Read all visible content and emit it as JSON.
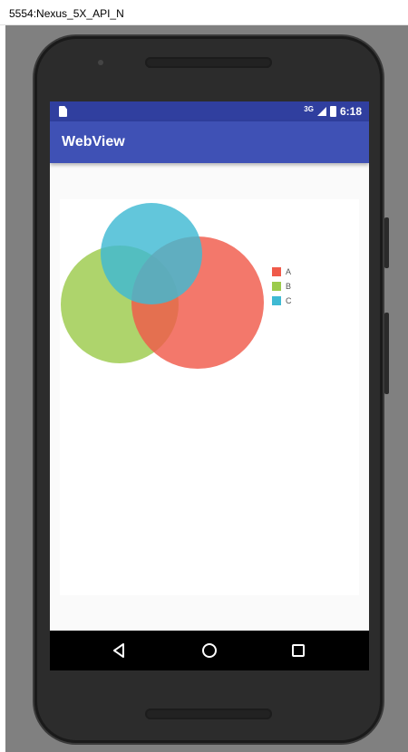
{
  "window": {
    "title": "5554:Nexus_5X_API_N"
  },
  "status_bar": {
    "network": "3G",
    "time": "6:18"
  },
  "app_bar": {
    "title": "WebView"
  },
  "chart_data": {
    "type": "venn",
    "sets": [
      {
        "name": "A",
        "color": "#f05a4a"
      },
      {
        "name": "B",
        "color": "#9ccb4c"
      },
      {
        "name": "C",
        "color": "#3fbad3"
      }
    ],
    "legend_position": "right",
    "title": ""
  },
  "nav_bar": {
    "buttons": [
      "back",
      "home",
      "recents"
    ]
  }
}
